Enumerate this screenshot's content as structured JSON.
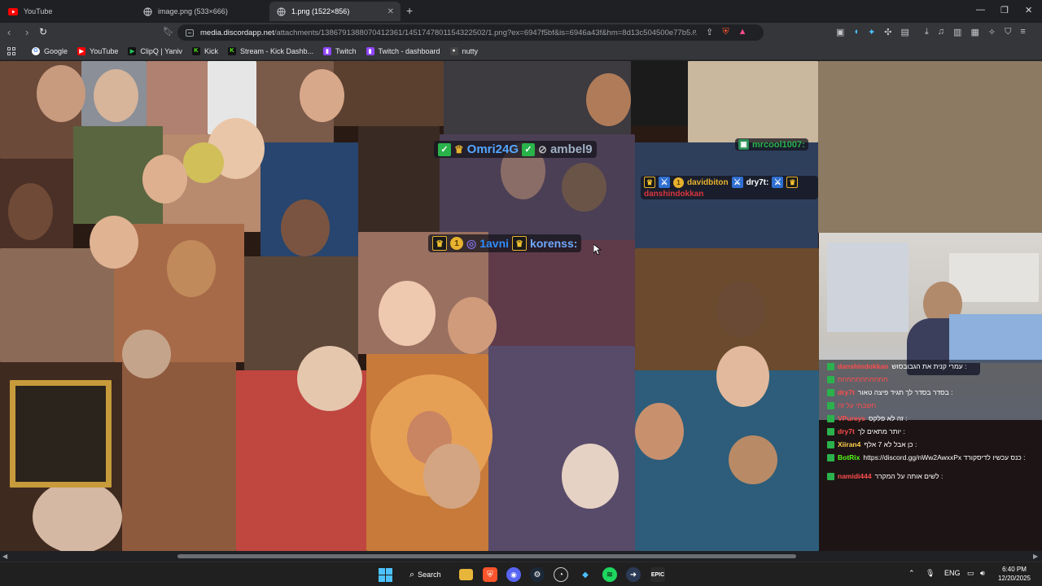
{
  "browser": {
    "tabs": [
      {
        "label": "YouTube",
        "favicon": "youtube-icon",
        "active": false
      },
      {
        "label": "image.png (533×666)",
        "favicon": "globe-icon",
        "active": false
      },
      {
        "label": "1.png (1522×856)",
        "favicon": "globe-icon",
        "active": true
      }
    ],
    "url": {
      "host": "media.discordapp.net",
      "path": "/attachments/1386791388070412361/1451747801154322502/1.png?ex=6947f5bf&is=6946a43f&hm=8d13c504500e77b5..."
    },
    "bookmarks": [
      {
        "label": "Google",
        "icon": "google-icon",
        "color": "#4285f4"
      },
      {
        "label": "YouTube",
        "icon": "youtube-icon",
        "color": "#ff0000"
      },
      {
        "label": "ClipQ | Yaniv",
        "icon": "clipq-icon",
        "color": "#22c55e"
      },
      {
        "label": "Kick",
        "icon": "kick-icon",
        "color": "#53fc18"
      },
      {
        "label": "Stream - Kick Dashb...",
        "icon": "kick-icon",
        "color": "#53fc18"
      },
      {
        "label": "Twitch",
        "icon": "twitch-icon",
        "color": "#9146ff"
      },
      {
        "label": "Twitch - dashboard",
        "icon": "twitch-icon",
        "color": "#9146ff"
      },
      {
        "label": "nutty",
        "icon": "nutty-icon",
        "color": "#cccccc"
      }
    ]
  },
  "image": {
    "overlays": {
      "chip1": {
        "user1": "Omri24G",
        "user2": "ambel9"
      },
      "chip2": {
        "user1": "1avni",
        "user2": "korenss:"
      },
      "chip3": {
        "user": "mrcool1007:"
      },
      "chip4": {
        "user1": "davidbiton",
        "user2": "dry7t:",
        "user3": "danshindokkan"
      }
    },
    "chat": [
      {
        "user": "danshindokkan",
        "msg": "עמרי קנית את הגבובסוש :",
        "color": "#ff4d4d"
      },
      {
        "user": "",
        "msg": "חחחחחחחחחחח",
        "color": "#ff4d4d"
      },
      {
        "user": "dry7t",
        "msg": "בסדר בסדר לך תגיד פיצה טאור :",
        "color": "#ff4d4d"
      },
      {
        "user": "",
        "msg": "חשבתי על זה",
        "color": "#ff4d4d"
      },
      {
        "user": "VPureys",
        "msg": "זה לא פלקס :",
        "color": "#ff4d4d"
      },
      {
        "user": "dry7t",
        "msg": "יותר מתאים לך :",
        "color": "#ff4d4d"
      },
      {
        "user": "Xiiran4",
        "msg": "כן אבל לא 7 אלף :",
        "color": "#ffd24d"
      },
      {
        "user": "BotRix",
        "msg": "https://discord.gg/nWw2AwxxPx כנס עכשיו לדיסקורד :",
        "color": "#53fc18"
      },
      {
        "user": "namidi444",
        "msg": "לשים אותה על המקרר :",
        "color": "#ff4d4d"
      }
    ]
  },
  "taskbar": {
    "search_label": "Search",
    "lang": "ENG",
    "time": "6:40 PM",
    "date": "12/20/2025"
  }
}
